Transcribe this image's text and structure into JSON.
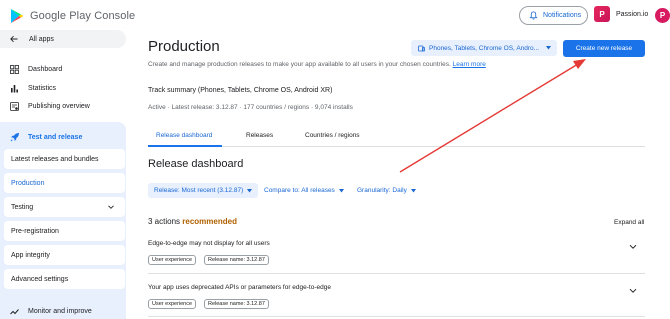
{
  "topbar": {
    "brand_prefix": "Google Play",
    "brand_suffix": "Console",
    "notifications_label": "Notifications",
    "app_name": "Passion.io",
    "app_icon_letter": "P",
    "avatar_letter": "P"
  },
  "sidebar": {
    "all_apps": "All apps",
    "items": [
      {
        "label": "Dashboard",
        "icon": "dashboard-icon"
      },
      {
        "label": "Statistics",
        "icon": "bar-chart-icon"
      },
      {
        "label": "Publishing overview",
        "icon": "publishing-icon"
      }
    ],
    "group_label": "Test and release",
    "sub_items": [
      {
        "label": "Latest releases and bundles"
      },
      {
        "label": "Production"
      },
      {
        "label": "Testing"
      },
      {
        "label": "Pre-registration"
      },
      {
        "label": "App integrity"
      },
      {
        "label": "Advanced settings"
      }
    ],
    "monitor_label": "Monitor and improve"
  },
  "main": {
    "title": "Production",
    "subtitle": "Create and manage production releases to make your app available to all users in your chosen countries.",
    "learn_more": "Learn more",
    "device_selector": "Phones, Tablets, Chrome OS, Andro...",
    "create_button": "Create new release",
    "track_title": "Track summary (Phones, Tablets, Chrome OS, Android XR)",
    "track_info": "Active  ·  Latest release: 3.12.87  ·  177 countries / regions  ·  9,074 installs",
    "tabs": [
      {
        "label": "Release dashboard"
      },
      {
        "label": "Releases"
      },
      {
        "label": "Countries / regions"
      }
    ],
    "section_title": "Release dashboard",
    "filters": [
      {
        "label": "Release: Most recent (3.12.87)"
      },
      {
        "label": "Compare to: All releases"
      },
      {
        "label": "Granularity: Daily"
      }
    ],
    "actions_count": "3 actions",
    "actions_recommended": "recommended",
    "expand_all": "Expand all",
    "actions": [
      {
        "title": "Edge-to-edge may not display for all users",
        "chips": [
          "User experience",
          "Release name: 3.12.87"
        ]
      },
      {
        "title": "Your app uses deprecated APIs or parameters for edge-to-edge",
        "chips": [
          "User experience",
          "Release name: 3.12.87"
        ]
      }
    ]
  },
  "colors": {
    "accent": "#1a73e8",
    "selected_bg": "#e8f0fe",
    "recommended": "#b06000",
    "annotation_arrow": "#e53935"
  }
}
